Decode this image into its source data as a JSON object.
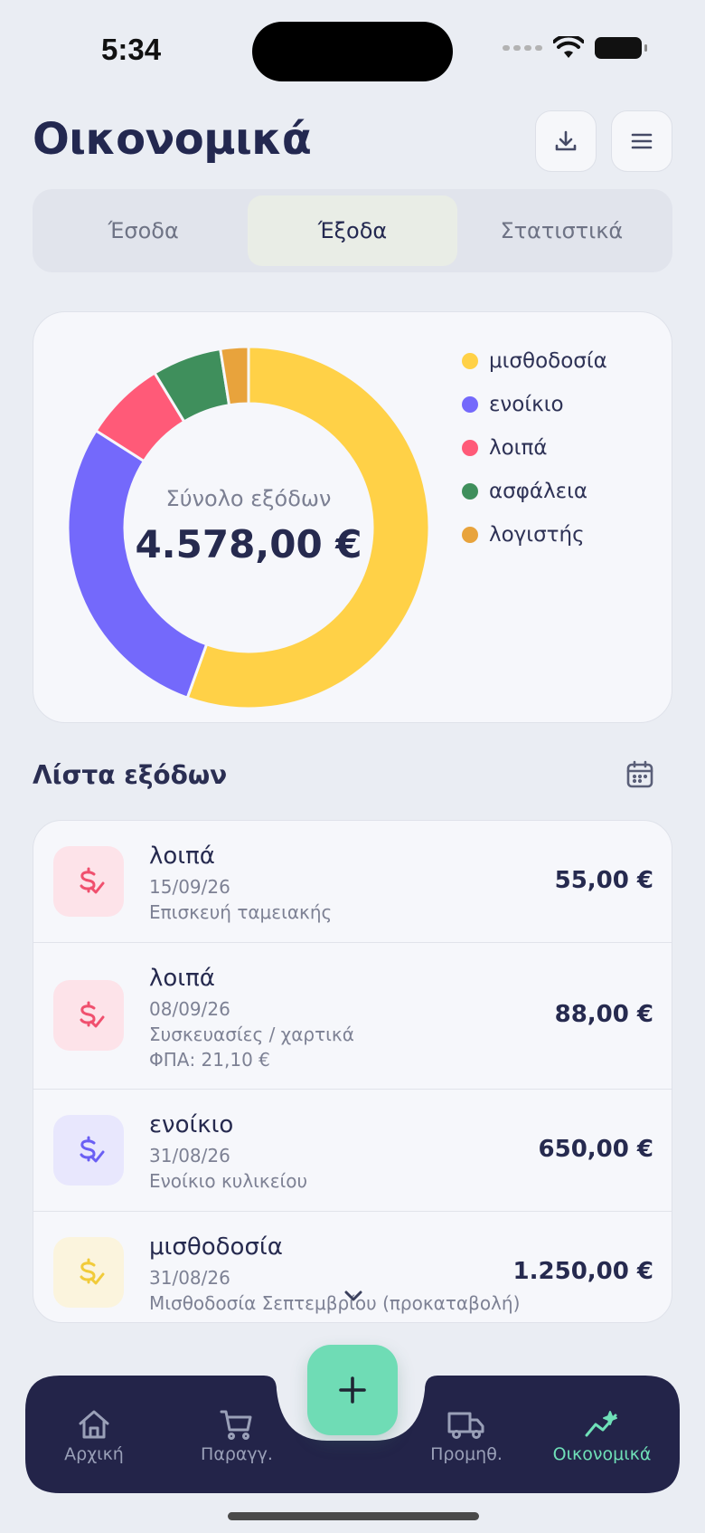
{
  "status": {
    "time": "5:34"
  },
  "header": {
    "title": "Οικονομικά"
  },
  "tabs": [
    {
      "label": "Έσοδα",
      "active": false
    },
    {
      "label": "Έξοδα",
      "active": true
    },
    {
      "label": "Στατιστικά",
      "active": false
    }
  ],
  "summary": {
    "label": "Σύνολο εξόδων",
    "total": "4.578,00 €"
  },
  "chart_data": {
    "type": "pie",
    "categories": [
      "μισθοδοσία",
      "ενοίκιο",
      "λοιπά",
      "ασφάλεια",
      "λογιστής"
    ],
    "values": [
      55.5,
      28.5,
      7.3,
      6.2,
      2.5
    ],
    "colors": [
      "#ffd147",
      "#7469fb",
      "#ff5a78",
      "#3f8f5c",
      "#e8a33c"
    ]
  },
  "list": {
    "title": "Λίστα εξόδων",
    "items": [
      {
        "category": "λοιπά",
        "date": "15/09/26",
        "description": "Επισκευή ταμειακής",
        "vat": "",
        "amount": "55,00 €",
        "icon_bg": "#fde3e9",
        "icon_color": "#f0506e"
      },
      {
        "category": "λοιπά",
        "date": "08/09/26",
        "description": "Συσκευασίες / χαρτικά",
        "vat": "ΦΠΑ: 21,10 €",
        "amount": "88,00 €",
        "icon_bg": "#fde3e9",
        "icon_color": "#f0506e"
      },
      {
        "category": "ενοίκιο",
        "date": "31/08/26",
        "description": "Ενοίκιο κυλικείου",
        "vat": "",
        "amount": "650,00 €",
        "icon_bg": "#e8e7fd",
        "icon_color": "#6a5ff4"
      },
      {
        "category": "μισθοδοσία",
        "date": "31/08/26",
        "description": "Μισθοδοσία Σεπτεμβρίου (προκαταβολή)",
        "vat": "",
        "amount": "1.250,00 €",
        "icon_bg": "#fbf4dd",
        "icon_color": "#f1cb3a"
      }
    ]
  },
  "nav": {
    "items": [
      {
        "label": "Αρχική",
        "icon": "home-icon",
        "active": false
      },
      {
        "label": "Παραγγ.",
        "icon": "cart-icon",
        "active": false
      },
      {
        "label": "Προμηθ.",
        "icon": "truck-icon",
        "active": false
      },
      {
        "label": "Οικονομικά",
        "icon": "trend-icon",
        "active": true
      }
    ],
    "fab_icon": "plus-icon"
  }
}
